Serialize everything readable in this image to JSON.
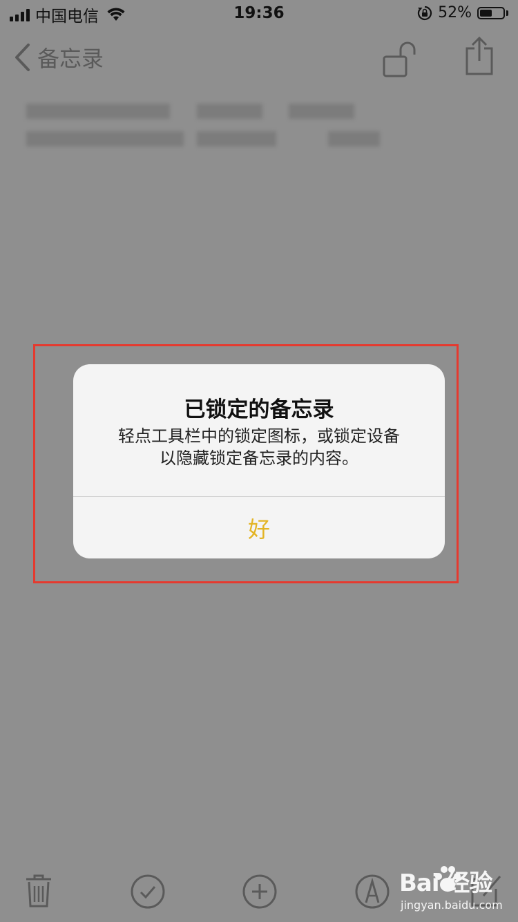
{
  "status_bar": {
    "carrier": "中国电信",
    "time": "19:36",
    "battery_percent": "52%",
    "battery_level": 0.52
  },
  "nav": {
    "back_label": "备忘录"
  },
  "alert": {
    "title": "已锁定的备忘录",
    "message_line1": "轻点工具栏中的锁定图标，或锁定设备",
    "message_line2": "以隐藏锁定备忘录的内容。",
    "ok_label": "好"
  },
  "toolbar": {
    "icons": [
      "trash-icon",
      "checkmark-icon",
      "add-icon",
      "markup-icon",
      "compose-icon"
    ]
  },
  "watermark": {
    "brand": "Bai 经验",
    "url": "jingyan.baidu.com"
  },
  "colors": {
    "accent": "#e3b424",
    "highlight": "#e53a2f",
    "dim_background": "#8f8f8f"
  }
}
